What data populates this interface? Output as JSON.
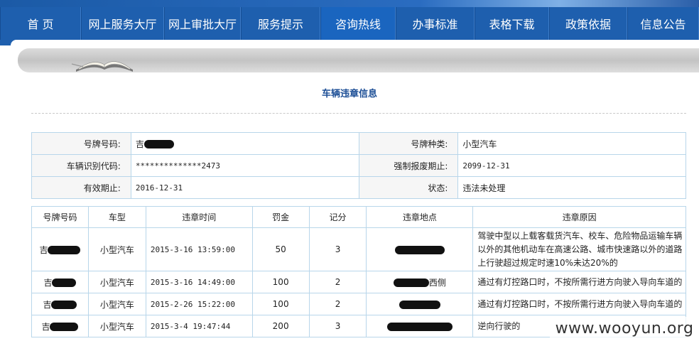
{
  "nav": {
    "items": [
      {
        "label": "首 页",
        "width": 114
      },
      {
        "label": "网上服务大厅",
        "width": 117
      },
      {
        "label": "网上审批大厅",
        "width": 108
      },
      {
        "label": "服务提示",
        "width": 112
      },
      {
        "label": "咨询热线",
        "width": 106
      },
      {
        "label": "办事标准",
        "width": 111
      },
      {
        "label": "表格下载",
        "width": 105
      },
      {
        "label": "政策依据",
        "width": 110
      },
      {
        "label": "信息公告",
        "width": 101
      }
    ],
    "active_index": 4
  },
  "page_title": "车辆违章信息",
  "vehicle": {
    "plate_label": "号牌号码:",
    "plate_value": "吉",
    "plate_type_label": "号牌种类:",
    "plate_type_value": "小型汽车",
    "vin_label": "车辆识别代码:",
    "vin_value": "**************2473",
    "scrap_label": "强制报废期止:",
    "scrap_value": "2099-12-31",
    "valid_label": "有效期止:",
    "valid_value": "2016-12-31",
    "status_label": "状态:",
    "status_value": "违法未处理"
  },
  "violations": {
    "headers": [
      "号牌号码",
      "车型",
      "违章时间",
      "罚金",
      "记分",
      "违章地点",
      "违章原因"
    ],
    "rows": [
      {
        "plate": "吉",
        "type": "小型汽车",
        "time": "2015-3-16 13:59:00",
        "fine": "50",
        "points": "3",
        "place": "",
        "reason": "驾驶中型以上载客载货汽车、校车、危险物品运输车辆以外的其他机动车在高速公路、城市快速路以外的道路上行驶超过规定时速10%未达20%的"
      },
      {
        "plate": "吉",
        "type": "小型汽车",
        "time": "2015-3-16 14:49:00",
        "fine": "100",
        "points": "2",
        "place": "西侧",
        "reason": "通过有灯控路口时，不按所需行进方向驶入导向车道的"
      },
      {
        "plate": "吉",
        "type": "小型汽车",
        "time": "2015-2-26 15:22:00",
        "fine": "100",
        "points": "2",
        "place": "",
        "reason": "通过有灯控路口时，不按所需行进方向驶入导向车道的"
      },
      {
        "plate": "吉",
        "type": "小型汽车",
        "time": "2015-3-4 19:47:44",
        "fine": "200",
        "points": "3",
        "place": "",
        "reason": "逆向行驶的"
      }
    ]
  },
  "watermark": "www.wooyun.org"
}
